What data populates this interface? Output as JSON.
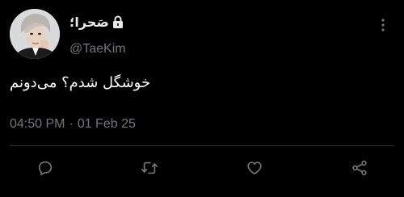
{
  "tweet": {
    "display_name": "صَحرا؛",
    "handle": "@TaeKim",
    "text": "خوشگل شدم؟ می‌دونم",
    "time": "04:50 PM",
    "separator": "·",
    "date": "01 Feb 25",
    "protected": true
  },
  "icons": {
    "lock": "lock-icon",
    "more": "more-vertical-icon",
    "reply": "reply-icon",
    "retweet": "retweet-icon",
    "like": "heart-icon",
    "share": "share-icon"
  },
  "colors": {
    "background": "#000000",
    "text": "#e7e9ea",
    "muted": "#71767b",
    "divider": "#2f3336"
  }
}
